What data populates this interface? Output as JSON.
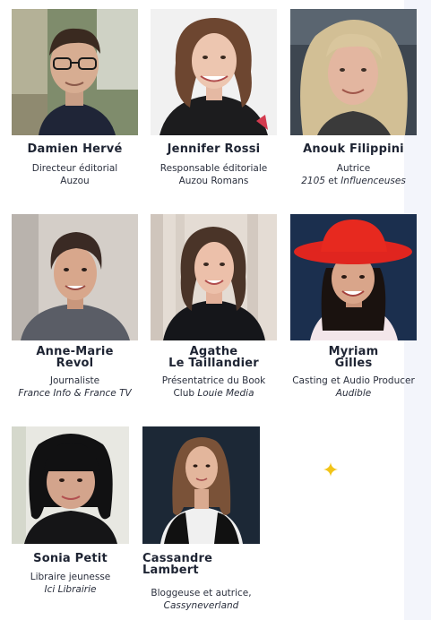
{
  "people": [
    {
      "name": "Damien Hervé",
      "role_line1": "Directeur éditorial",
      "role_line2": "Auzou"
    },
    {
      "name": "Jennifer Rossi",
      "role_line1": "Responsable éditoriale",
      "role_line2": "Auzou Romans"
    },
    {
      "name": "Anouk Filippini",
      "role_line1": "Autrice",
      "role_line2_italic1": "2105",
      "role_line2_joiner": " et ",
      "role_line2_italic2": "Influenceuses"
    },
    {
      "name_line1": "Anne-Marie",
      "name_line2": "Revol",
      "role_line1": "Journaliste",
      "role_line2": "France Info & France TV"
    },
    {
      "name_line1": "Agathe",
      "name_line2": "Le Taillandier",
      "role_line1": "Présentatrice du Book",
      "role_line2_plain": "Club ",
      "role_line2_italic": "Louie Media"
    },
    {
      "name_line1": "Myriam",
      "name_line2": "Gilles",
      "role_line1": "Casting et Audio Producer",
      "role_line2": "Audible"
    },
    {
      "name": "Sonia Petit",
      "role_line1": "Libraire jeunesse",
      "role_line2": "Ici Librairie"
    },
    {
      "name_line1": "Cassandre",
      "name_line2": "Lambert",
      "role_line1": "Bloggeuse et autrice,",
      "role_line2": "Cassyneverland"
    }
  ],
  "colors": {
    "name_text": "#1e2433",
    "sparkle": "#f2c418",
    "side_panel": "#f3f5fb"
  },
  "icons": {
    "decoration": "sparkle-icon"
  }
}
